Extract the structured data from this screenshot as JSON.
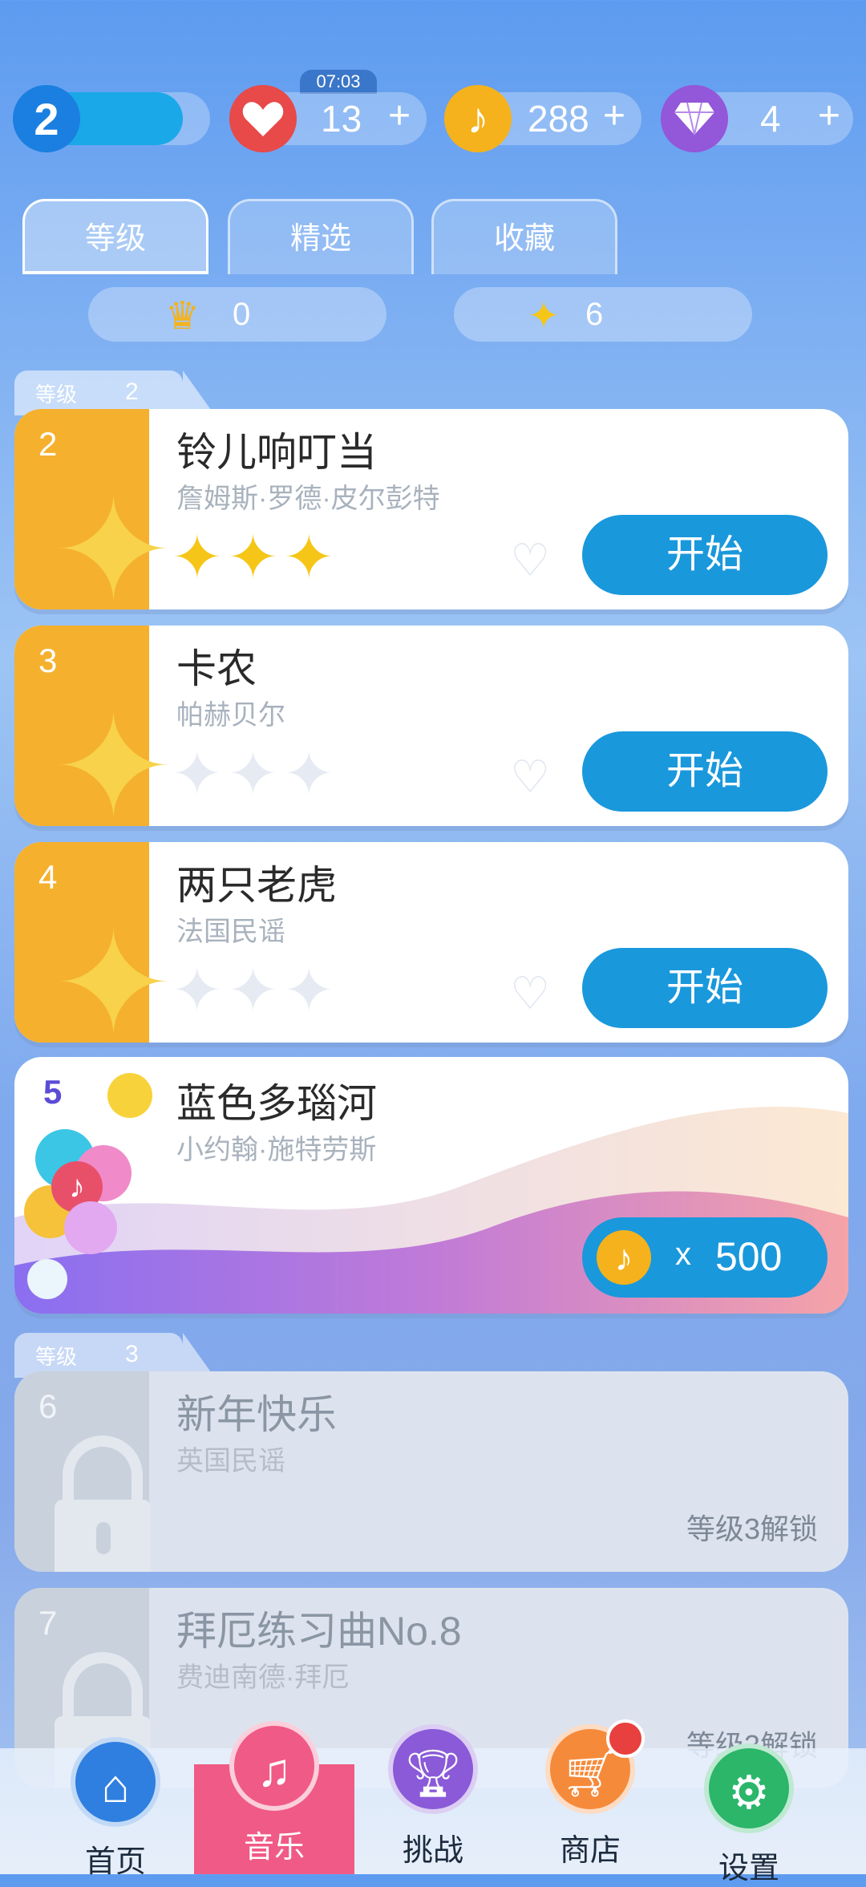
{
  "currency_bar": {
    "level": "2",
    "timer": "07:03",
    "lives": "13",
    "notes": "288",
    "gems": "4",
    "plus": "+"
  },
  "tabs": [
    {
      "label": "等级",
      "active": true
    },
    {
      "label": "精选",
      "active": false
    },
    {
      "label": "收藏",
      "active": false
    }
  ],
  "stats": {
    "crowns": "0",
    "stars": "6"
  },
  "groups": [
    {
      "label": "等级",
      "level": "2"
    },
    {
      "label": "等级",
      "level": "3"
    }
  ],
  "songs": [
    {
      "num": "2",
      "title": "铃儿响叮当",
      "artist": "詹姆斯·罗德·皮尔彭特",
      "stars_earned": 3,
      "button": "开始"
    },
    {
      "num": "3",
      "title": "卡农",
      "artist": "帕赫贝尔",
      "stars_earned": 0,
      "button": "开始"
    },
    {
      "num": "4",
      "title": "两只老虎",
      "artist": "法国民谣",
      "stars_earned": 0,
      "button": "开始"
    },
    {
      "num": "5",
      "title": "蓝色多瑙河",
      "artist": "小约翰·施特劳斯",
      "cost_prefix": "x",
      "cost": "500"
    },
    {
      "num": "6",
      "title": "新年快乐",
      "artist": "英国民谣",
      "unlock": "等级3解锁"
    },
    {
      "num": "7",
      "title": "拜厄练习曲No.8",
      "artist": "费迪南德·拜厄",
      "unlock": "等级3解锁"
    }
  ],
  "nav": [
    {
      "label": "首页",
      "icon": "home-icon",
      "color": "#2f7fe0"
    },
    {
      "label": "音乐",
      "icon": "music-note-icon",
      "color": "#f05a86",
      "active": true
    },
    {
      "label": "挑战",
      "icon": "trophy-icon",
      "color": "#8a5ad8"
    },
    {
      "label": "商店",
      "icon": "cart-icon",
      "color": "#f58a3a"
    },
    {
      "label": "设置",
      "icon": "gear-icon",
      "color": "#2bb66a"
    }
  ]
}
